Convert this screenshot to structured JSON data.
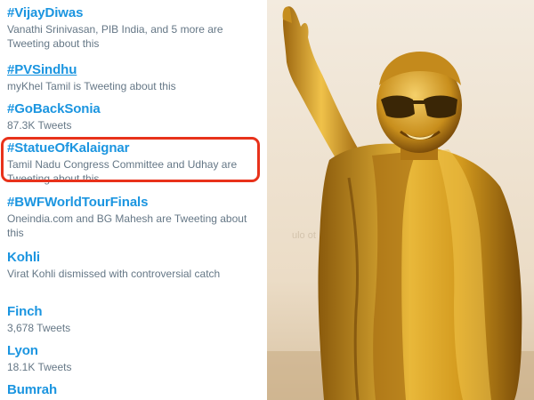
{
  "trends": [
    {
      "title": "#VijayDiwas",
      "meta": "Vanathi Srinivasan, PIB India, and 5 more are Tweeting about this"
    },
    {
      "title": "#PVSindhu",
      "meta": "myKhel Tamil is Tweeting about this"
    },
    {
      "title": "#GoBackSonia",
      "meta": "87.3K Tweets"
    },
    {
      "title": "#StatueOfKalaignar",
      "meta": "Tamil Nadu Congress Committee and Udhay are Tweeting about this"
    },
    {
      "title": "#BWFWorldTourFinals",
      "meta": "Oneindia.com and BG Mahesh are Tweeting about this"
    },
    {
      "title": "Kohli",
      "meta": "Virat Kohli dismissed with controversial catch"
    },
    {
      "title": "Finch",
      "meta": "3,678 Tweets"
    },
    {
      "title": "Lyon",
      "meta": "18.1K Tweets"
    },
    {
      "title": "Bumrah",
      "meta": ""
    }
  ],
  "colors": {
    "trend_title": "#1b95e0",
    "trend_meta": "#657786",
    "highlight_border": "#e8321b"
  }
}
